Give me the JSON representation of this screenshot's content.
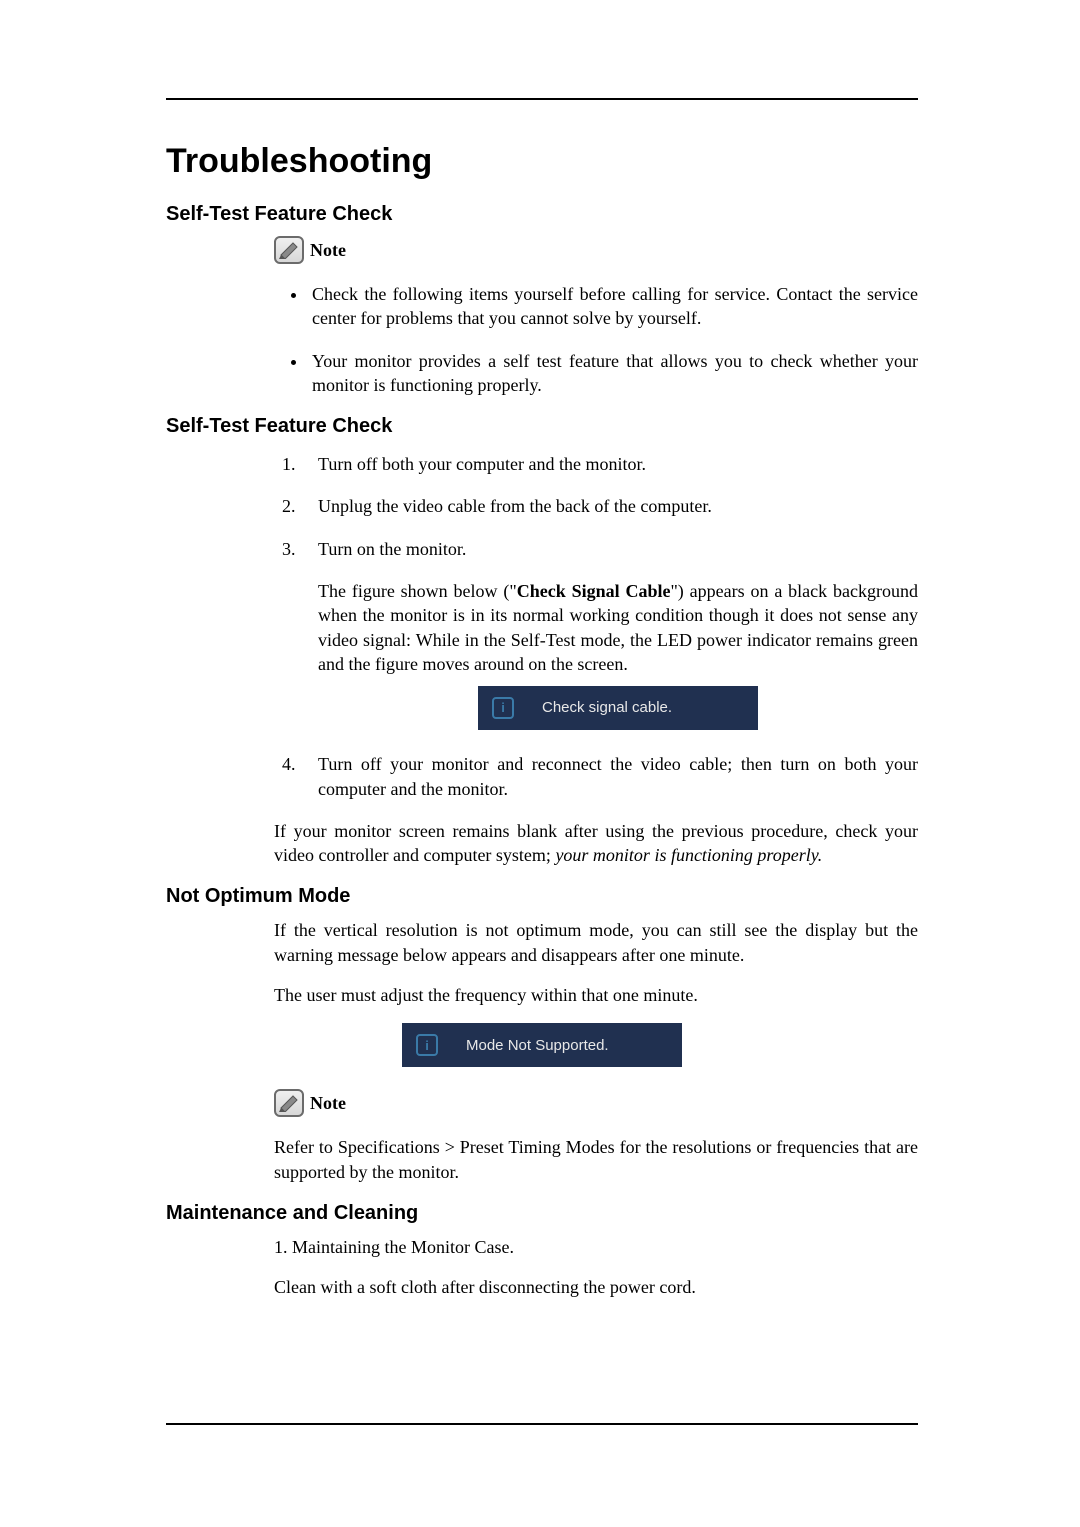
{
  "title": "Troubleshooting",
  "sections": {
    "s1": {
      "heading": "Self-Test Feature Check",
      "note_label": "Note",
      "bullets": [
        "Check the following items yourself before calling for service. Contact the service center for problems that you cannot solve by yourself.",
        "Your monitor provides a self test feature that allows you to check whether your monitor is functioning properly."
      ]
    },
    "s2": {
      "heading": "Self-Test Feature Check",
      "steps": {
        "step1": "Turn off both your computer and the monitor.",
        "step2": "Unplug the video cable from the back of the computer.",
        "step3": "Turn on the monitor.",
        "step3_extra_pre": "The figure shown below (\"",
        "step3_extra_bold": "Check Signal Cable",
        "step3_extra_post": "\") appears on a black background when the monitor is in its normal working condition though it does not sense any video signal: While in the Self-Test mode, the LED power indicator remains green and the figure moves around on the screen.",
        "step4": "Turn off your monitor and reconnect the video cable; then turn on both your computer and the monitor."
      },
      "osd1_text": "Check signal cable.",
      "after_pre": "If your monitor screen remains blank after using the previous procedure, check your video controller and computer system; ",
      "after_italic": "your monitor is functioning properly."
    },
    "s3": {
      "heading": "Not Optimum Mode",
      "p1": "If the vertical resolution is not optimum mode, you can still see the display but the warning message below appears and disappears after one minute.",
      "p2": "The user must adjust the frequency within that one minute.",
      "osd2_text": "Mode Not Supported.",
      "note_label": "Note",
      "note_text": "Refer to Specifications > Preset Timing Modes for the resolutions or frequencies that are supported by the monitor."
    },
    "s4": {
      "heading": "Maintenance and Cleaning",
      "p1": "1. Maintaining the Monitor Case.",
      "p2": "Clean with a soft cloth after disconnecting the power cord."
    }
  },
  "icons": {
    "note": "note-icon",
    "info": "info-icon"
  }
}
